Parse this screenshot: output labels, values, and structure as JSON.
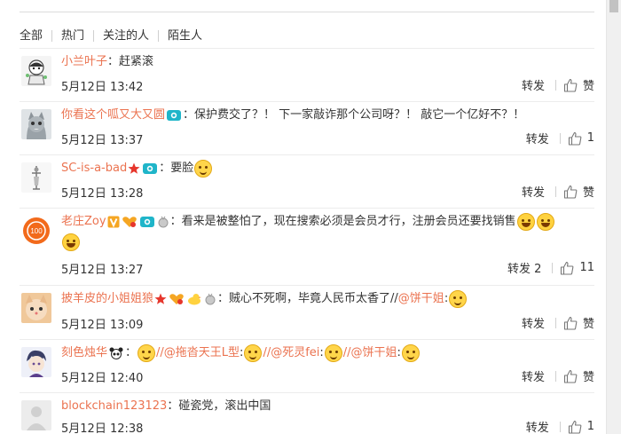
{
  "tabs": [
    "全部",
    "热门",
    "关注的人",
    "陌生人"
  ],
  "actions": {
    "forward_label": "转发",
    "like_label": "赞"
  },
  "colors": {
    "username": "#eb7350",
    "text": "#333333",
    "divider": "#ececec"
  },
  "comments": [
    {
      "user": "小兰叶子",
      "sep": "：",
      "text": "赶紧滚",
      "time": "5月12日 13:42",
      "forward": "转发",
      "like": "赞"
    },
    {
      "user": "你看这个呱又大又圆",
      "sep": "：",
      "text": "保护费交了？！ 下一家敲诈那个公司呀？！ 敲它一个亿好不？！",
      "time": "5月12日 13:37",
      "forward": "转发",
      "like": "1"
    },
    {
      "user": "SC-is-a-bad",
      "sep": "：",
      "text": "要脸",
      "time": "5月12日 13:28",
      "forward": "转发",
      "like": "赞"
    },
    {
      "user": "老庄Zoy",
      "sep": "：",
      "text": "看来是被整怕了，现在搜索必须是会员才行，注册会员还要找销售",
      "time": "5月12日 13:27",
      "forward": "转发 2",
      "like": "11"
    },
    {
      "user": "披羊皮的小姐姐狼",
      "sep": "：",
      "text": "贼心不死啊，毕竟人民币太香了//",
      "mention": "@饼干姐",
      "mention_sep": ":",
      "time": "5月12日 13:09",
      "forward": "转发",
      "like": "赞"
    },
    {
      "user": "刻色烛华",
      "sep": "：",
      "m1": "//@拖沓天王L型",
      "m1_sep": ":",
      "m2": "//@死灵fei",
      "m2_sep": ":",
      "m3": "//@饼干姐",
      "m3_sep": ":",
      "time": "5月12日 12:40",
      "forward": "转发",
      "like": "赞"
    },
    {
      "user": "blockchain123123",
      "sep": "：",
      "text": "碰瓷党，滚出中国",
      "time": "5月12日 12:38",
      "forward": "转发",
      "like": "1"
    }
  ]
}
